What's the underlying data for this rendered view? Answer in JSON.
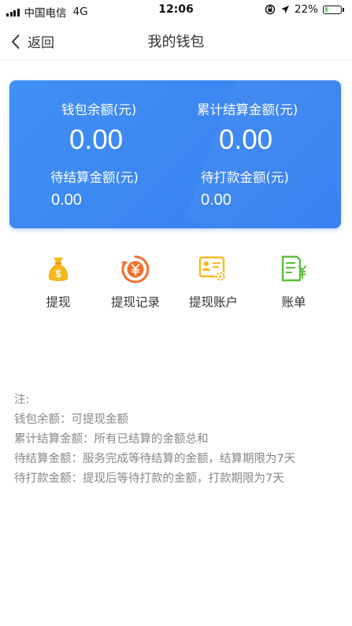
{
  "status_bar": {
    "carrier": "中国电信",
    "network": "4G",
    "time": "12:06",
    "battery_percent": "22%",
    "battery_level": 0.22
  },
  "nav": {
    "back_label": "返回",
    "title": "我的钱包"
  },
  "wallet": {
    "balance_label": "钱包余额(元)",
    "balance_value": "0.00",
    "total_settled_label": "累计结算金额(元)",
    "total_settled_value": "0.00",
    "pending_settlement_label": "待结算金额(元)",
    "pending_settlement_value": "0.00",
    "pending_payment_label": "待打款金额(元)",
    "pending_payment_value": "0.00"
  },
  "actions": [
    {
      "label": "提现",
      "icon": "money-bag-icon"
    },
    {
      "label": "提现记录",
      "icon": "withdraw-record-icon"
    },
    {
      "label": "提现账户",
      "icon": "account-card-icon"
    },
    {
      "label": "账单",
      "icon": "bill-icon"
    }
  ],
  "notes": {
    "title": "注:",
    "lines": [
      "钱包余额：可提现金额",
      "累计结算金额：所有已结算的金额总和",
      "待结算金额：服务完成等待结算的金额，结算期限为7天",
      "待打款金额：提现后等待打款的金额，打款期限为7天"
    ]
  },
  "colors": {
    "card_blue": "#3b86f2",
    "icon_yellow": "#f5b81f",
    "icon_orange": "#f0702b",
    "icon_green": "#5cbf3c"
  }
}
